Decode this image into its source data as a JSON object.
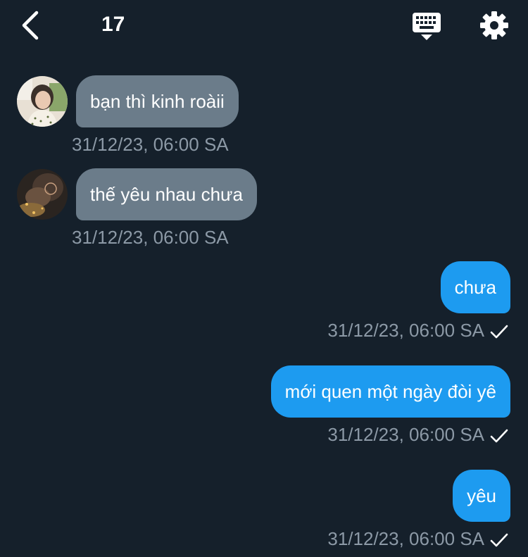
{
  "header": {
    "title": "17",
    "back_icon": "chevron-left-icon",
    "keyboard_icon": "keyboard-icon",
    "settings_icon": "gear-icon"
  },
  "colors": {
    "background": "#15202b",
    "incoming_bubble": "#6b7c8a",
    "outgoing_bubble": "#1d9bf0",
    "timestamp": "#8c99a6"
  },
  "messages": [
    {
      "direction": "incoming",
      "text": "bạn thì kinh roàii",
      "time": "31/12/23, 06:00 SA"
    },
    {
      "direction": "incoming",
      "text": "thế yêu nhau chưa",
      "time": "31/12/23, 06:00 SA"
    },
    {
      "direction": "outgoing",
      "text": "chưa",
      "time": "31/12/23, 06:00 SA",
      "status_icon": "check-icon"
    },
    {
      "direction": "outgoing",
      "text": "mới quen một ngày đòi yê",
      "time": "31/12/23, 06:00 SA",
      "status_icon": "check-icon"
    },
    {
      "direction": "outgoing",
      "text": "yêu",
      "time": "31/12/23, 06:00 SA",
      "status_icon": "check-icon"
    }
  ]
}
